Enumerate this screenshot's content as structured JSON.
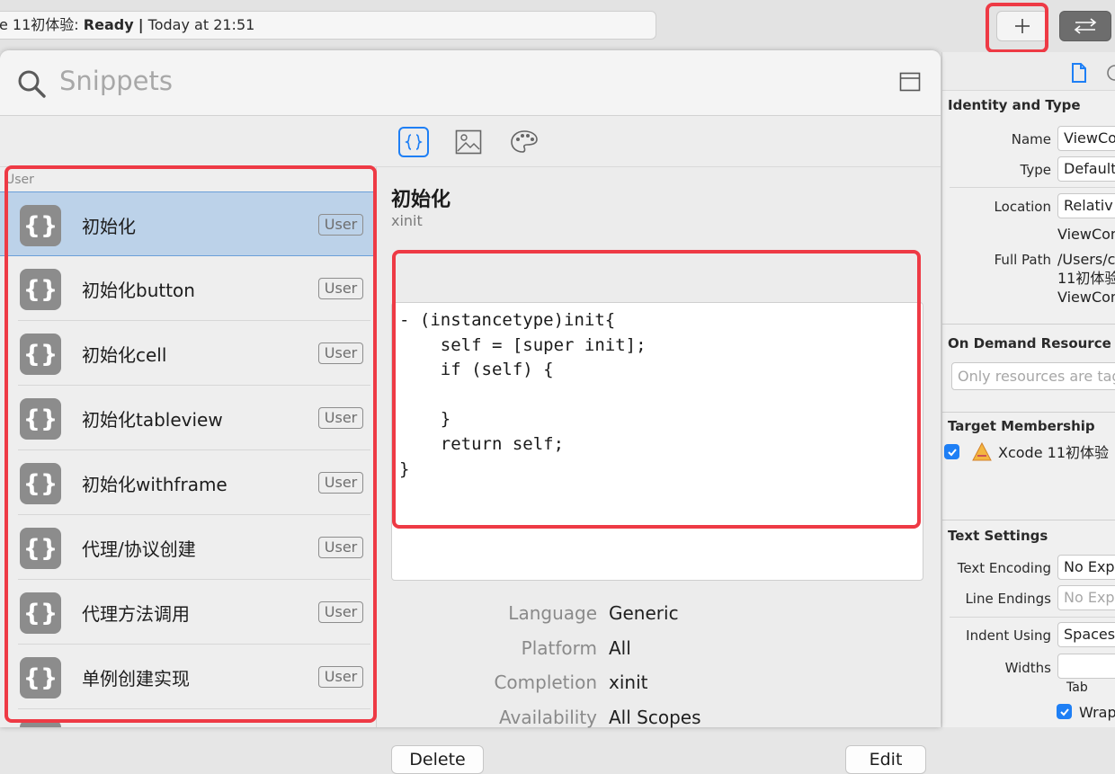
{
  "toolbar": {
    "status_project": "e 11初体验:",
    "status_state": "Ready",
    "status_sep": "|",
    "status_time": "Today at 21:51",
    "add_label": "+",
    "swap_label": "⇄"
  },
  "library": {
    "search_placeholder": "Snippets",
    "tabs": [
      "code-snippets",
      "media",
      "colors"
    ],
    "group_label": "User",
    "items": [
      {
        "title": "初始化",
        "badge": "User",
        "selected": true
      },
      {
        "title": "初始化button",
        "badge": "User"
      },
      {
        "title": "初始化cell",
        "badge": "User"
      },
      {
        "title": "初始化tableview",
        "badge": "User"
      },
      {
        "title": "初始化withframe",
        "badge": "User"
      },
      {
        "title": "代理/协议创建",
        "badge": "User"
      },
      {
        "title": "代理方法调用",
        "badge": "User"
      },
      {
        "title": "单例创建实现",
        "badge": "User"
      }
    ],
    "snippet_icon": "{}"
  },
  "detail": {
    "title": "初始化",
    "shortcut": "xinit",
    "code": "- (instancetype)init{\n    self = [super init];\n    if (self) {\n\n    }\n    return self;\n}",
    "meta": [
      {
        "label": "Language",
        "value": "Generic"
      },
      {
        "label": "Platform",
        "value": "All"
      },
      {
        "label": "Completion",
        "value": "xinit"
      },
      {
        "label": "Availability",
        "value": "All Scopes"
      }
    ],
    "delete_label": "Delete",
    "edit_label": "Edit"
  },
  "inspector": {
    "identity_title": "Identity and Type",
    "name_label": "Name",
    "name_value": "ViewCo",
    "type_label": "Type",
    "type_value": "Default",
    "location_label": "Location",
    "location_value": "Relativ",
    "location_file": "ViewCon",
    "fullpath_label": "Full Path",
    "fullpath_lines": [
      "/Users/c",
      "11初体验",
      "ViewCon"
    ],
    "odr_title": "On Demand Resource Ta",
    "odr_placeholder": "Only resources are tag",
    "target_title": "Target Membership",
    "target_name": "Xcode 11初体验",
    "text_title": "Text Settings",
    "encoding_label": "Text Encoding",
    "encoding_value": "No Exp",
    "endings_label": "Line Endings",
    "endings_value": "No Exp",
    "indent_label": "Indent Using",
    "indent_value": "Spaces",
    "widths_label": "Widths",
    "tab_label": "Tab",
    "wrap_label": "Wrap"
  },
  "colors": {
    "accent": "#1e7ff5",
    "highlight": "#ee3a45",
    "selected_row": "#bcd2e9"
  }
}
